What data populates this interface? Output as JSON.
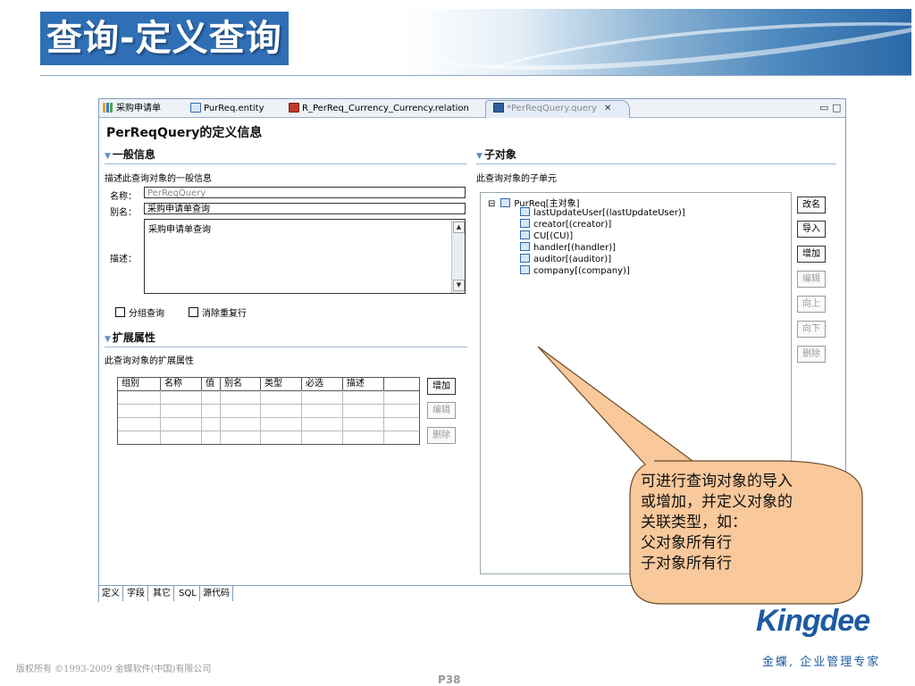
{
  "slide": {
    "title": "查询-定义查询",
    "copyright": "版权所有 ©1993-2009 金蝶软件(中国)有限公司",
    "page": "P38",
    "logo": "Kingdee",
    "slogan": "金蝶, 企业管理专家"
  },
  "editor": {
    "tabs": [
      {
        "label": "采购申请单",
        "icon": "chart-icon"
      },
      {
        "label": "PurReq.entity",
        "icon": "entity-icon"
      },
      {
        "label": "R_PerReq_Currency_Currency.relation",
        "icon": "relation-icon"
      },
      {
        "label": "*PerReqQuery.query",
        "icon": "query-icon",
        "active": true
      }
    ],
    "form_title": "PerReqQuery的定义信息",
    "general": {
      "title": "一般信息",
      "desc": "描述此查询对象的一般信息",
      "name_label": "名称：",
      "name_value": "PerReqQuery",
      "alias_label": "别名：",
      "alias_value": "采购申请单查询",
      "desc_label": "描述：",
      "desc_value": "采购申请单查询",
      "group_query": "分组查询",
      "dedupe": "消除重复行"
    },
    "extended": {
      "title": "扩展属性",
      "desc": "此查询对象的扩展属性",
      "columns": [
        "组别",
        "名称",
        "值",
        "别名",
        "类型",
        "必选",
        "描述"
      ],
      "buttons": {
        "add": "增加",
        "edit": "编辑",
        "delete": "删除"
      }
    },
    "children": {
      "title": "子对象",
      "desc": "此查询对象的子单元",
      "tree_root": "PurReq[主对象]",
      "tree_items": [
        "lastUpdateUser[(lastUpdateUser)]",
        "creator[(creator)]",
        "CU[(CU)]",
        "handler[(handler)]",
        "auditor[(auditor)]",
        "company[(company)]"
      ],
      "buttons": {
        "rename": "改名",
        "import": "导入",
        "add": "增加",
        "edit": "编辑",
        "up": "向上",
        "down": "向下",
        "delete": "删除"
      }
    },
    "bottom_tabs": [
      "定义",
      "字段",
      "其它",
      "SQL",
      "源代码"
    ]
  },
  "callout": {
    "lines": [
      "可进行查询对象的导入",
      "或增加，并定义对象的",
      "关联类型，如：",
      "父对象所有行",
      "子对象所有行"
    ],
    "fill": "#f9c89b"
  }
}
